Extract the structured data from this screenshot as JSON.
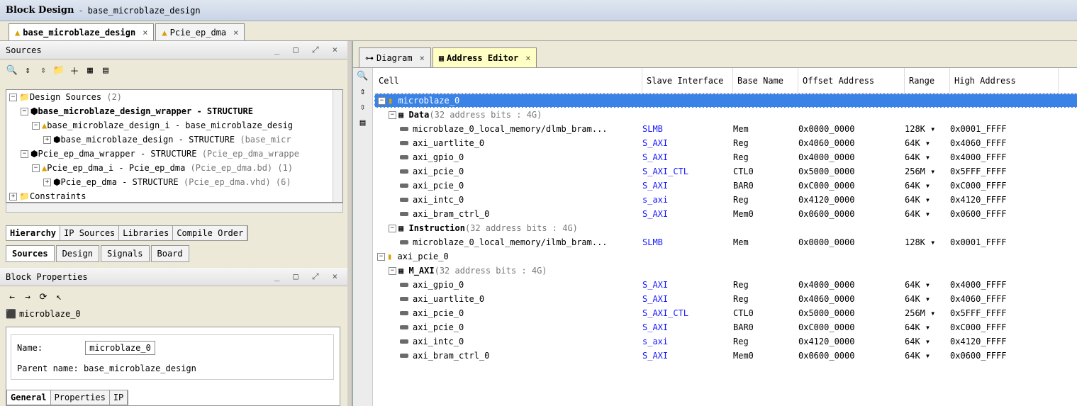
{
  "window": {
    "title": "Block Design",
    "subtitle": "base_microblaze_design"
  },
  "doc_tabs": [
    {
      "label": "base_microblaze_design"
    },
    {
      "label": "Pcie_ep_dma"
    }
  ],
  "sources": {
    "title": "Sources",
    "tree": [
      {
        "label": "Design Sources",
        "count": "(2)"
      },
      {
        "label": "base_microblaze_design_wrapper - STRUCTURE",
        "extra": ""
      },
      {
        "label": "base_microblaze_design_i - base_microblaze_desig",
        "extra": ""
      },
      {
        "label": "base_microblaze_design - STRUCTURE",
        "extra": "(base_micr"
      },
      {
        "label": "Pcie_ep_dma_wrapper - STRUCTURE",
        "extra": "(Pcie_ep_dma_wrappe"
      },
      {
        "label": "Pcie_ep_dma_i - Pcie_ep_dma",
        "extra": "(Pcie_ep_dma.bd) (1)"
      },
      {
        "label": "Pcie_ep_dma - STRUCTURE",
        "extra": "(Pcie_ep_dma.vhd) (6)"
      },
      {
        "label": "Constraints",
        "extra": ""
      }
    ],
    "subtabs": [
      "Hierarchy",
      "IP Sources",
      "Libraries",
      "Compile Order"
    ],
    "bottomtabs": [
      "Sources",
      "Design",
      "Signals",
      "Board"
    ]
  },
  "block_properties": {
    "title": "Block Properties",
    "selected": "microblaze_0",
    "name_label": "Name:",
    "name_value": "microblaze_0",
    "parent_label": "Parent name:",
    "parent_value": "base_microblaze_design",
    "tabs": [
      "General",
      "Properties",
      "IP"
    ]
  },
  "right_tabs": [
    {
      "label": "Diagram"
    },
    {
      "label": "Address Editor"
    }
  ],
  "table": {
    "headers": [
      "Cell",
      "Slave Interface",
      "Base Name",
      "Offset Address",
      "Range",
      "High Address"
    ],
    "rows": [
      {
        "level": 0,
        "cell": "microblaze_0",
        "slave": "",
        "base": "",
        "offset": "",
        "range": "",
        "high": "",
        "sel": true
      },
      {
        "level": 1,
        "cell": "Data",
        "suffix": "(32 address bits : 4G)",
        "slave": "",
        "base": "",
        "offset": "",
        "range": "",
        "high": ""
      },
      {
        "level": 2,
        "cell": "microblaze_0_local_memory/dlmb_bram...",
        "slave": "SLMB",
        "base": "Mem",
        "offset": "0x0000_0000",
        "range": "128K",
        "high": "0x0001_FFFF"
      },
      {
        "level": 2,
        "cell": "axi_uartlite_0",
        "slave": "S_AXI",
        "base": "Reg",
        "offset": "0x4060_0000",
        "range": "64K",
        "high": "0x4060_FFFF"
      },
      {
        "level": 2,
        "cell": "axi_gpio_0",
        "slave": "S_AXI",
        "base": "Reg",
        "offset": "0x4000_0000",
        "range": "64K",
        "high": "0x4000_FFFF"
      },
      {
        "level": 2,
        "cell": "axi_pcie_0",
        "slave": "S_AXI_CTL",
        "base": "CTL0",
        "offset": "0x5000_0000",
        "range": "256M",
        "high": "0x5FFF_FFFF"
      },
      {
        "level": 2,
        "cell": "axi_pcie_0",
        "slave": "S_AXI",
        "base": "BAR0",
        "offset": "0xC000_0000",
        "range": "64K",
        "high": "0xC000_FFFF"
      },
      {
        "level": 2,
        "cell": "axi_intc_0",
        "slave": "s_axi",
        "base": "Reg",
        "offset": "0x4120_0000",
        "range": "64K",
        "high": "0x4120_FFFF"
      },
      {
        "level": 2,
        "cell": "axi_bram_ctrl_0",
        "slave": "S_AXI",
        "base": "Mem0",
        "offset": "0x0600_0000",
        "range": "64K",
        "high": "0x0600_FFFF"
      },
      {
        "level": 1,
        "cell": "Instruction",
        "suffix": "(32 address bits : 4G)",
        "slave": "",
        "base": "",
        "offset": "",
        "range": "",
        "high": ""
      },
      {
        "level": 2,
        "cell": "microblaze_0_local_memory/ilmb_bram...",
        "slave": "SLMB",
        "base": "Mem",
        "offset": "0x0000_0000",
        "range": "128K",
        "high": "0x0001_FFFF"
      },
      {
        "level": 0,
        "cell": "axi_pcie_0",
        "slave": "",
        "base": "",
        "offset": "",
        "range": "",
        "high": ""
      },
      {
        "level": 1,
        "cell": "M_AXI",
        "suffix": "(32 address bits : 4G)",
        "slave": "",
        "base": "",
        "offset": "",
        "range": "",
        "high": ""
      },
      {
        "level": 2,
        "cell": "axi_gpio_0",
        "slave": "S_AXI",
        "base": "Reg",
        "offset": "0x4000_0000",
        "range": "64K",
        "high": "0x4000_FFFF"
      },
      {
        "level": 2,
        "cell": "axi_uartlite_0",
        "slave": "S_AXI",
        "base": "Reg",
        "offset": "0x4060_0000",
        "range": "64K",
        "high": "0x4060_FFFF"
      },
      {
        "level": 2,
        "cell": "axi_pcie_0",
        "slave": "S_AXI_CTL",
        "base": "CTL0",
        "offset": "0x5000_0000",
        "range": "256M",
        "high": "0x5FFF_FFFF"
      },
      {
        "level": 2,
        "cell": "axi_pcie_0",
        "slave": "S_AXI",
        "base": "BAR0",
        "offset": "0xC000_0000",
        "range": "64K",
        "high": "0xC000_FFFF"
      },
      {
        "level": 2,
        "cell": "axi_intc_0",
        "slave": "s_axi",
        "base": "Reg",
        "offset": "0x4120_0000",
        "range": "64K",
        "high": "0x4120_FFFF"
      },
      {
        "level": 2,
        "cell": "axi_bram_ctrl_0",
        "slave": "S_AXI",
        "base": "Mem0",
        "offset": "0x0600_0000",
        "range": "64K",
        "high": "0x0600_FFFF"
      }
    ]
  }
}
